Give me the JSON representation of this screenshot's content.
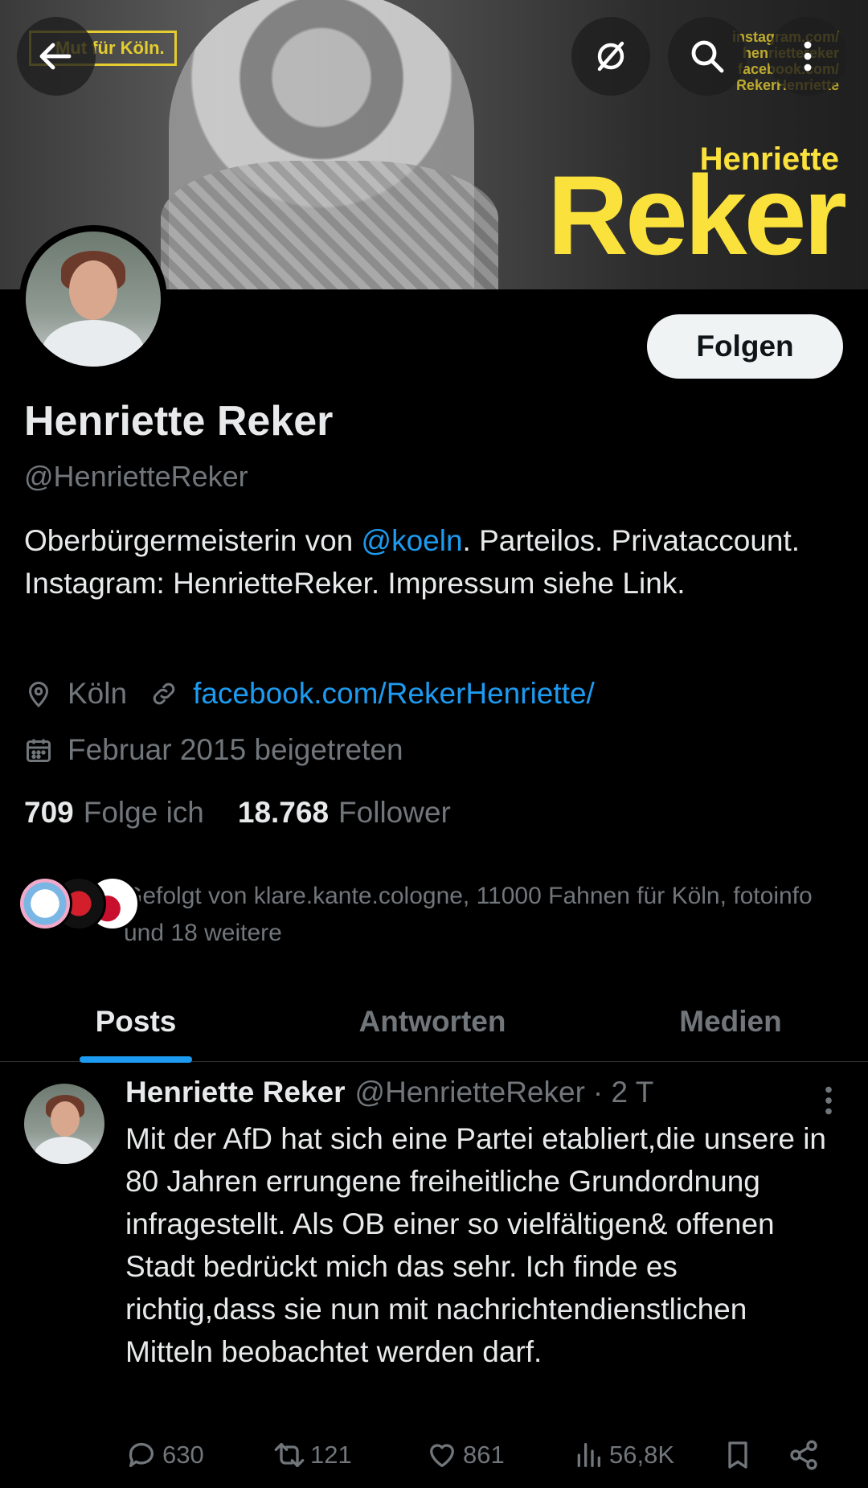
{
  "banner": {
    "tagline": "Mut für Köln.",
    "first_name": "Henriette",
    "last_name": "Reker",
    "social_lines": [
      "instagram.com/",
      "henriettereker",
      "facebook.com/",
      "RekerHenriette"
    ]
  },
  "header": {
    "back_icon": "arrow-left-icon",
    "grok_icon": "slash-circle-icon",
    "search_icon": "search-icon",
    "more_icon": "more-vertical-icon"
  },
  "profile": {
    "follow_label": "Folgen",
    "name": "Henriette Reker",
    "handle": "@HenrietteReker",
    "bio_before": "Oberbürgermeisterin von ",
    "bio_mention": "@koeln",
    "bio_after": ". Parteilos. Privataccount. Instagram: HenrietteReker. Impressum siehe Link.",
    "location": "Köln",
    "website": "facebook.com/RekerHenriette/",
    "joined": "Februar 2015 beigetreten",
    "following_count": "709",
    "following_label": "Folge ich",
    "followers_count": "18.768",
    "followers_label": "Follower",
    "followed_by": "Gefolgt von klare.kante.cologne, 11000 Fahnen für Köln, fotoinfo und 18 weitere"
  },
  "tabs": [
    {
      "label": "Posts",
      "active": true
    },
    {
      "label": "Antworten",
      "active": false
    },
    {
      "label": "Medien",
      "active": false
    }
  ],
  "post": {
    "author": "Henriette Reker",
    "handle": "@HenrietteReker",
    "time": "· 2 T",
    "text": "Mit der AfD hat sich eine Partei etabliert,die unsere in 80 Jahren errungene freiheitliche Grundordnung infragestellt. Als OB einer so vielfältigen& offenen Stadt bedrückt mich das sehr. Ich finde es richtig,dass sie nun mit nachrichtendienstlichen Mitteln beobachtet werden darf.",
    "replies": "630",
    "reposts": "121",
    "likes": "861",
    "views": "56,8K"
  },
  "colors": {
    "accent": "#1d9bf0",
    "muted": "#71767b",
    "banner_yellow": "#fbe13b"
  }
}
